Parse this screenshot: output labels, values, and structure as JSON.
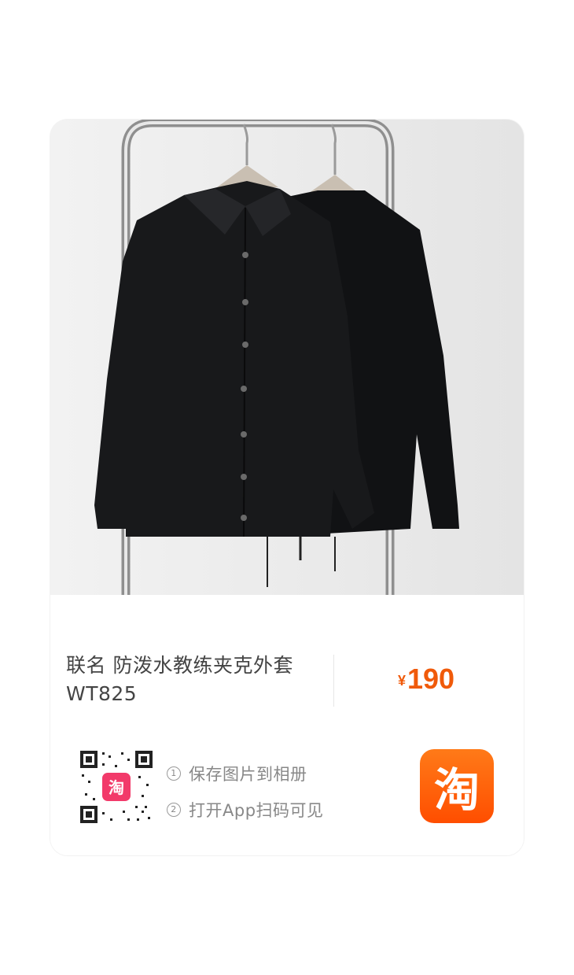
{
  "product": {
    "title_line1": "联名 防泼水教练夹克外套",
    "title_line2": "WT825",
    "currency": "¥",
    "price": "190",
    "accent_color": "#f05a0a"
  },
  "photo": {
    "subject": "two black coach jackets on a chrome clothes rack"
  },
  "qr": {
    "center_logo_text": "淘"
  },
  "tips": [
    {
      "number": "1",
      "text": "保存图片到相册"
    },
    {
      "number": "2",
      "text": "打开App扫码可见"
    }
  ],
  "app_icon": {
    "label": "淘",
    "color": "#ff5a00"
  }
}
